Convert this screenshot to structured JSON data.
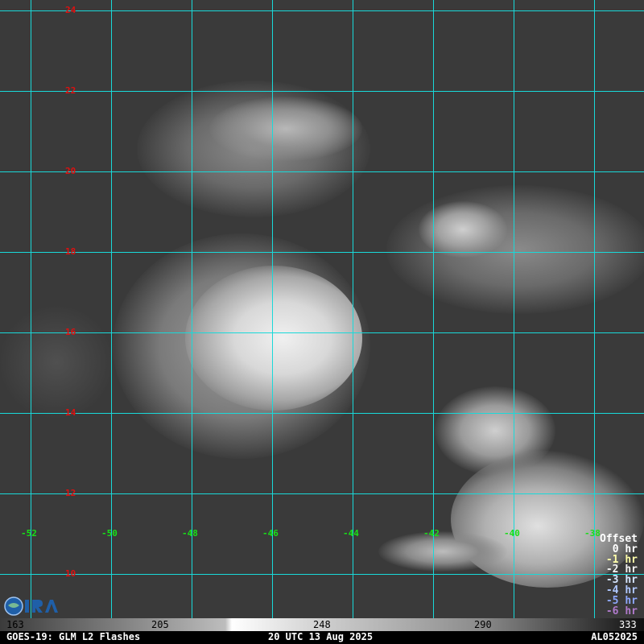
{
  "map": {
    "lat_labels": [
      "24",
      "22",
      "20",
      "18",
      "16",
      "14",
      "12",
      "10"
    ],
    "lon_labels": [
      "-52",
      "-50",
      "-48",
      "-46",
      "-44",
      "-42",
      "-40",
      "-38"
    ],
    "grid_color": "#19d9d9"
  },
  "legend": {
    "title": "Offset",
    "items": [
      {
        "label": "0 hr",
        "color": "#ffffff"
      },
      {
        "label": "-1 hr",
        "color": "#ffffaa"
      },
      {
        "label": "-2 hr",
        "color": "#f2f2f2"
      },
      {
        "label": "-3 hr",
        "color": "#d6e6ff"
      },
      {
        "label": "-4 hr",
        "color": "#b0c8ff"
      },
      {
        "label": "-5 hr",
        "color": "#8fa8ff"
      },
      {
        "label": "-6 hr",
        "color": "#b07acc"
      }
    ]
  },
  "colorbar": {
    "ticks": [
      "163",
      "205",
      "248",
      "290",
      "333"
    ]
  },
  "footer": {
    "left": "GOES-19: GLM L2 Flashes",
    "center": "20 UTC 13 Aug 2025",
    "right": "AL052025"
  }
}
